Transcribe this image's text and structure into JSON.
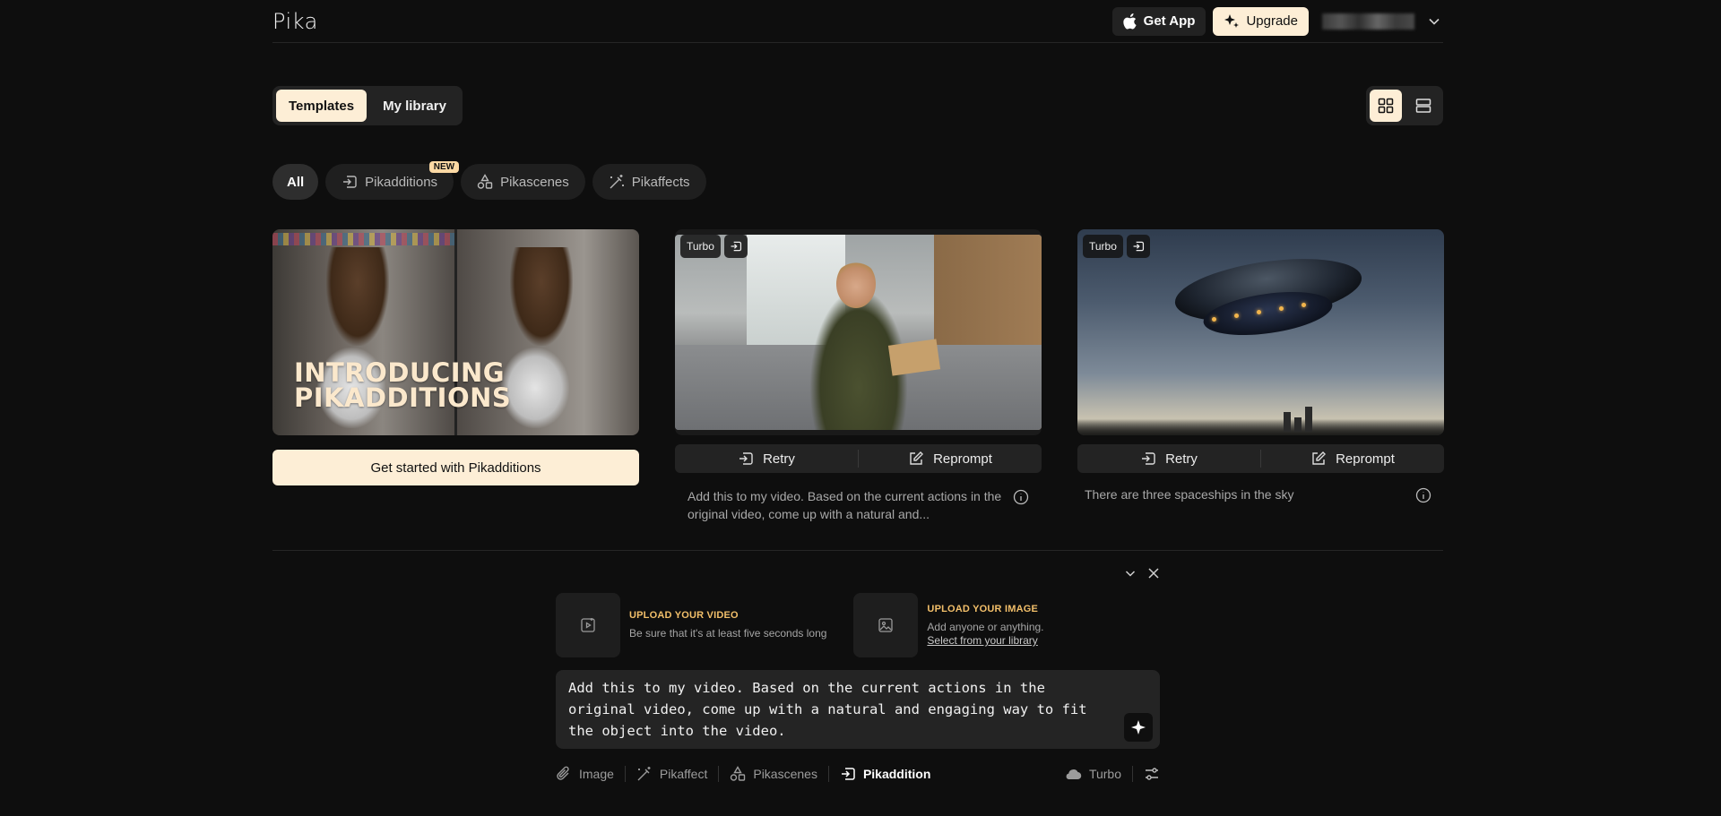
{
  "header": {
    "logo": "Pika",
    "get_app_label": "Get App",
    "upgrade_label": "Upgrade"
  },
  "tabs": [
    {
      "label": "Templates",
      "active": true
    },
    {
      "label": "My library",
      "active": false
    }
  ],
  "view_toggle": {
    "grid": "grid-view-icon",
    "list": "list-view-icon",
    "active": "grid"
  },
  "filters": [
    {
      "label": "All",
      "icon": "",
      "active": true
    },
    {
      "label": "Pikadditions",
      "icon": "pikaddition-icon",
      "badge": "NEW"
    },
    {
      "label": "Pikascenes",
      "icon": "shapes-icon"
    },
    {
      "label": "Pikaffects",
      "icon": "magic-wand-icon"
    }
  ],
  "cards": {
    "intro": {
      "title_line1": "INTRODUCING",
      "title_line2": "PIKADDITIONS",
      "cta": "Get started with Pikadditions"
    },
    "video1": {
      "badge": "Turbo",
      "retry": "Retry",
      "reprompt": "Reprompt",
      "prompt": "Add this to my video. Based on the current actions in the original video, come up with a natural and..."
    },
    "video2": {
      "badge": "Turbo",
      "retry": "Retry",
      "reprompt": "Reprompt",
      "prompt": "There are three spaceships in the sky"
    }
  },
  "composer": {
    "upload_video": {
      "title": "UPLOAD YOUR VIDEO",
      "desc": "Be sure that it's at least five seconds long"
    },
    "upload_image": {
      "title": "UPLOAD YOUR IMAGE",
      "desc": "Add anyone or anything.",
      "link": "Select from your library"
    },
    "prompt_text": "Add this to my video. Based on the current actions in the original video, come up with a natural and engaging way to fit the object into the video.",
    "toolbar": {
      "image": "Image",
      "pikaffect": "Pikaffect",
      "pikascenes": "Pikascenes",
      "pikaddition": "Pikaddition",
      "model": "Turbo"
    }
  },
  "colors": {
    "background": "#0e0e0e",
    "accent": "#fdeed6",
    "upload_title": "#f2bf6a"
  }
}
